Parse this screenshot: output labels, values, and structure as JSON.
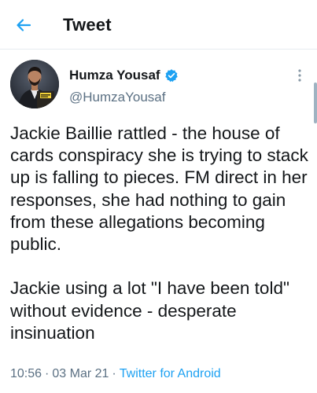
{
  "header": {
    "title": "Tweet"
  },
  "author": {
    "name": "Humza Yousaf",
    "handle": "@HumzaYousaf",
    "verified": true
  },
  "tweet": {
    "text": "Jackie Baillie rattled - the house of cards conspiracy she is trying to stack up is falling to pieces. FM direct in her responses, she had nothing to gain from these allegations becoming public.\n\nJackie using a lot \"I have been told\" without evidence - desperate insinuation",
    "time": "10:56",
    "date": "03 Mar 21",
    "source": "Twitter for Android",
    "separator": "·"
  },
  "colors": {
    "accent": "#1da1f2",
    "text_primary": "#14171a",
    "text_secondary": "#5b7083"
  },
  "icons": {
    "back": "arrow-left-icon",
    "verified": "verified-badge-icon",
    "more": "more-vertical-icon"
  }
}
